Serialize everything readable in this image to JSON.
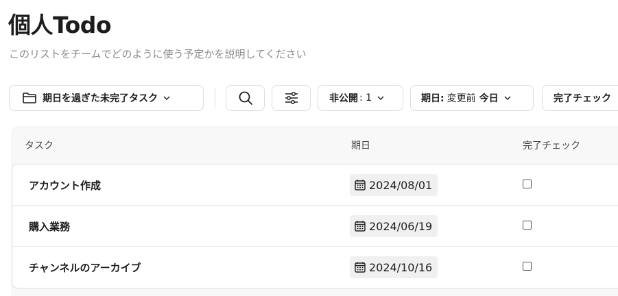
{
  "page": {
    "title": "個人Todo",
    "description": "このリストをチームでどのように使う予定かを説明してください"
  },
  "toolbar": {
    "view_filter": {
      "label": "期日を過ぎた未完了タスク",
      "icon": "folder-icon"
    },
    "search": {
      "icon": "search-icon"
    },
    "filters": {
      "icon": "sliders-icon"
    },
    "hidden": {
      "label": "非公開",
      "count": ": 1"
    },
    "due_date_sort": {
      "label": "期日:",
      "value_prefix": "変更前",
      "value_bold": "今日"
    },
    "completed": {
      "label": "完了チェック"
    }
  },
  "table": {
    "columns": [
      "タスク",
      "期日",
      "完了チェック"
    ],
    "rows": [
      {
        "task": "アカウント作成",
        "due": "2024/08/01",
        "completed": false
      },
      {
        "task": "購入業務",
        "due": "2024/06/19",
        "completed": false
      },
      {
        "task": "チャンネルのアーカイブ",
        "due": "2024/10/16",
        "completed": false
      }
    ]
  }
}
